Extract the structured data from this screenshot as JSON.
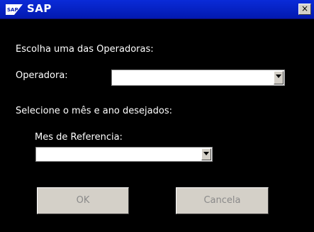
{
  "window": {
    "title": "SAP",
    "close_glyph": "×",
    "logo_icon": "sap-logo-icon"
  },
  "form": {
    "intro_label": "Escolha uma das Operadoras:",
    "operadora_label": "Operadora:",
    "operadora_value": "",
    "period_label": "Selecione o mês e ano desejados:",
    "mes_label": "Mes de Referencia:",
    "mes_value": ""
  },
  "buttons": {
    "ok_label": "OK",
    "cancel_label": "Cancela"
  },
  "colors": {
    "titlebar": "#0219b0",
    "background": "#000000",
    "button_face": "#d4d0c8",
    "disabled_text": "#8a8a8a"
  }
}
